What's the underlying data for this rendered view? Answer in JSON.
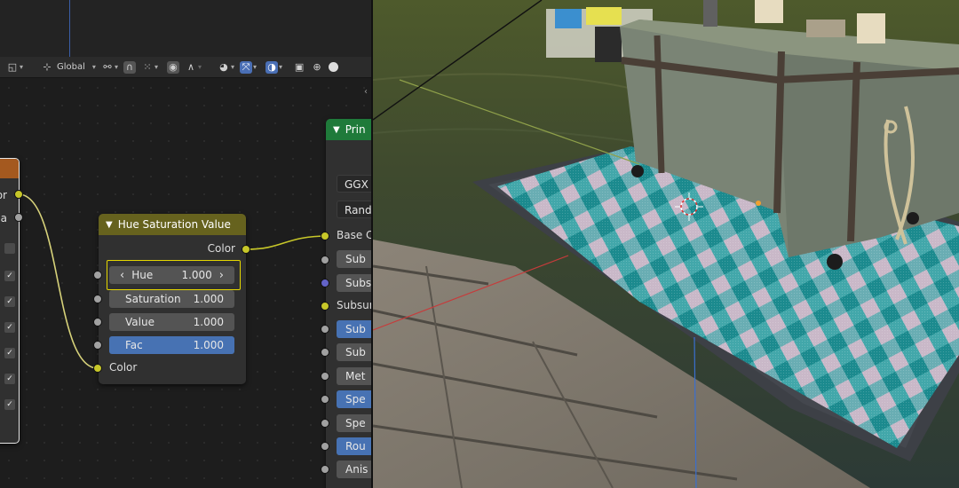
{
  "header": {
    "transform_orientation": "Global"
  },
  "left_node": {
    "outputs": [
      "or",
      "ha"
    ]
  },
  "hsv_node": {
    "title": "Hue Saturation Value",
    "output_label": "Color",
    "fields": [
      {
        "label": "Hue",
        "value": "1.000"
      },
      {
        "label": "Saturation",
        "value": "1.000"
      },
      {
        "label": "Value",
        "value": "1.000"
      },
      {
        "label": "Fac",
        "value": "1.000"
      }
    ],
    "input_color_label": "Color"
  },
  "principled_node": {
    "title": "Prin",
    "distribution": "GGX",
    "subsurface_method": "Rand",
    "rows": [
      "Base C",
      "Sub",
      "Subsu",
      "Subsur",
      "Sub",
      "Sub",
      "Met",
      "Spe",
      "Spe",
      "Rou",
      "Anis"
    ]
  },
  "colors": {
    "color_socket": "#c7c729",
    "float_socket": "#a1a1a1",
    "vector_socket": "#6363c7",
    "hsv_header": "#66621e",
    "principled_header": "#1f7a3a",
    "texture_header": "#a4591f",
    "selection_highlight": "#e6d800",
    "field_active": "#4772b3"
  },
  "icons": {
    "header": [
      "transform-orientation-icon",
      "pivot-icon",
      "snap-icon",
      "proportional-icon",
      "overlay-icon",
      "gizmo-icon",
      "xray-icon",
      "shading-wire-icon",
      "shading-solid-icon"
    ]
  }
}
